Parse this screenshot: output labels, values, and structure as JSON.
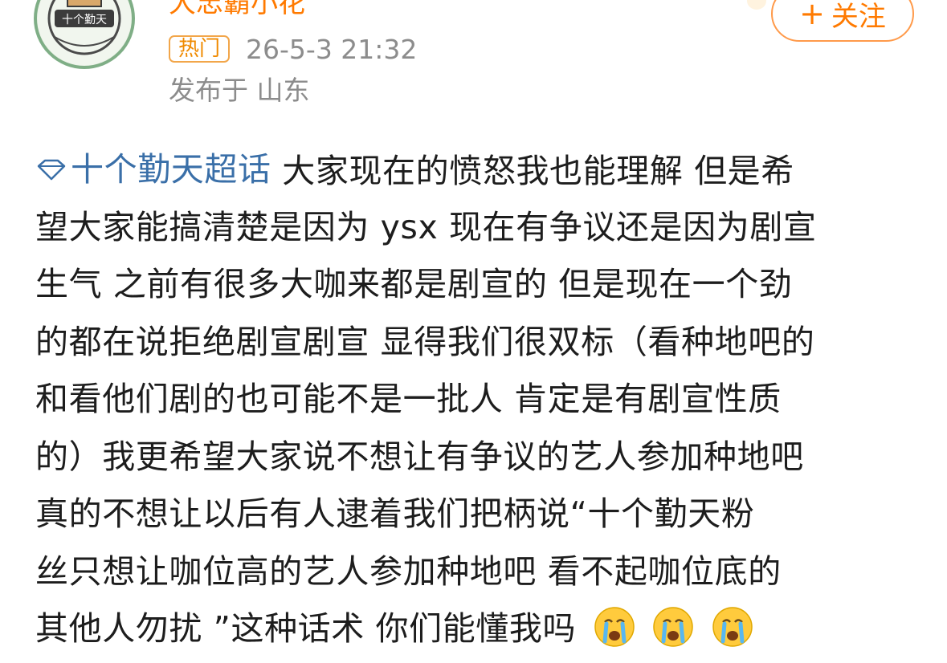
{
  "user": {
    "name": "大忠霸小花",
    "avatar_label": "十个勤天"
  },
  "meta": {
    "badge": "热门",
    "time": "26-5-3 21:32",
    "location": "发布于 山东"
  },
  "follow_button": {
    "label": "关注"
  },
  "post": {
    "topic": "十个勤天超话",
    "lines": [
      " 大家现在的愤怒我也能理解 但是希",
      "望大家能搞清楚是因为 ysx 现在有争议还是因为剧宣",
      "生气 之前有很多大咖来都是剧宣的 但是现在一个劲",
      "的都在说拒绝剧宣剧宣 显得我们很双标（看种地吧的",
      "和看他们剧的也可能不是一批人 肯定是有剧宣性质",
      "的）我更希望大家说不想让有争议的艺人参加种地吧",
      " 真的不想让以后有人逮着我们把柄说“十个勤天粉",
      "丝只想让咖位高的艺人参加种地吧 看不起咖位底的",
      "其他人勿扰 ”这种话术 你们能懂我吗"
    ],
    "emoji_names": [
      "crying-face-icon",
      "crying-face-icon",
      "crying-face-icon"
    ]
  },
  "colors": {
    "username": "#ff7a00",
    "topic": "#3a6fa8",
    "meta": "#8c8c8c",
    "badge": "#f08a00"
  }
}
